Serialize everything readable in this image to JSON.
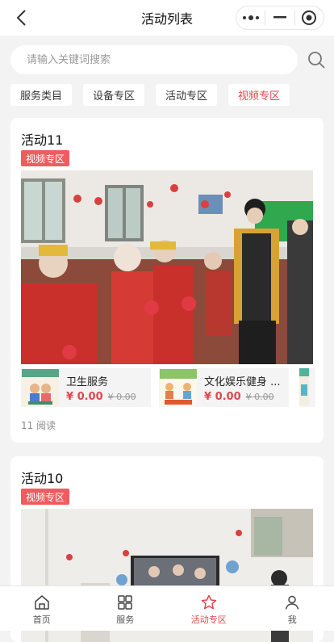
{
  "header": {
    "title": "活动列表",
    "back_icon": "chevron-left-icon",
    "more_icon": "more-dots-icon",
    "minimize_icon": "minus-icon",
    "close_icon": "target-circle-icon"
  },
  "search": {
    "placeholder": "请输入关键词搜索",
    "value": "",
    "icon": "search-icon"
  },
  "categories": [
    {
      "label": "服务类目",
      "active": false
    },
    {
      "label": "设备专区",
      "active": false
    },
    {
      "label": "活动专区",
      "active": false
    },
    {
      "label": "视频专区",
      "active": true
    }
  ],
  "activities": [
    {
      "title": "活动11",
      "badge": "视频专区",
      "products": [
        {
          "name": "卫生服务",
          "price": "¥ 0.00",
          "original_price": "¥ 0.00"
        },
        {
          "name": "文化娱乐健身 ...",
          "price": "¥ 0.00",
          "original_price": "¥ 0.00"
        }
      ],
      "reads": "11 阅读"
    },
    {
      "title": "活动10",
      "badge": "视频专区"
    }
  ],
  "tabbar": [
    {
      "label": "首页",
      "icon": "home-icon",
      "active": false
    },
    {
      "label": "服务",
      "icon": "grid-icon",
      "active": false
    },
    {
      "label": "活动专区",
      "icon": "star-icon",
      "active": true
    },
    {
      "label": "我",
      "icon": "user-icon",
      "active": false
    }
  ],
  "colors": {
    "accent": "#e0474d",
    "badge": "#ef5c5f",
    "background": "#f3f3f3"
  }
}
